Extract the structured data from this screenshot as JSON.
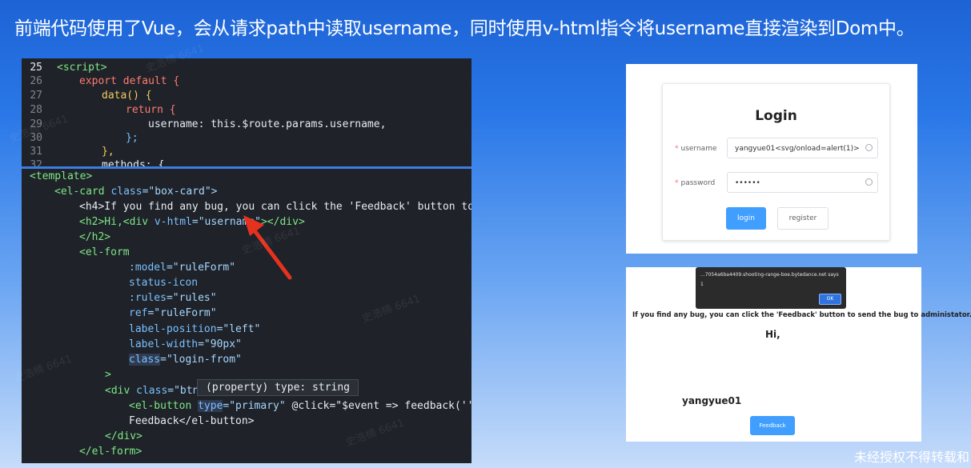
{
  "title": "前端代码使用了Vue，会从请求path中读取username，同时使用v-html指令将username直接渲染到Dom中。",
  "code_top": {
    "lines": [
      {
        "num": "25",
        "text": "<script>"
      },
      {
        "num": "26",
        "text": "export default {"
      },
      {
        "num": "27",
        "text": "data() {"
      },
      {
        "num": "28",
        "text": "return {"
      },
      {
        "num": "29",
        "text": "username: this.$route.params.username,"
      },
      {
        "num": "30",
        "text": "};"
      },
      {
        "num": "31",
        "text": "},"
      },
      {
        "num": "32",
        "text": "methods: {"
      }
    ]
  },
  "code_bottom": {
    "l1": "<template>",
    "l2a": "<el-card ",
    "l2b": "class",
    "l2c": "=\"box-card\">",
    "l3": "<h4>If you find any bug, you can click the 'Feedback' button to",
    "l4a": "<h2>Hi,<div ",
    "l4b": "v-html",
    "l4c": "=\"username\"",
    "l4d": "></div>",
    "l5": "</h2>",
    "l6": "<el-form",
    "l7a": ":model",
    "l7b": "=\"ruleForm\"",
    "l8": "status-icon",
    "l9a": ":rules",
    "l9b": "=\"rules\"",
    "l10a": "ref",
    "l10b": "=\"ruleForm\"",
    "l11a": "label-position",
    "l11b": "=\"left\"",
    "l12a": "label-width",
    "l12b": "=\"90px\"",
    "l13a": "class",
    "l13b": "=\"login-from\"",
    "l14": ">",
    "l15a": "<div ",
    "l15b": "class",
    "l15c": "=\"btn",
    "l16a": "<el-button ",
    "l16b": "type",
    "l16c": "=\"primary\"",
    "l16d": " @click=\"$event => feedback(''",
    "l17": "Feedback</el-button>",
    "l18": "</div>",
    "l19": "</el-form>",
    "tooltip": "(property) type: string"
  },
  "login": {
    "title": "Login",
    "username_label": "username",
    "username_value": "yangyue01<svg/onload=alert(1)>",
    "password_label": "password",
    "password_value": "••••••",
    "login_button": "login",
    "register_button": "register"
  },
  "result": {
    "alert_host": "...7054a6ba4409.shooting-range-boe.bytedance.net says",
    "alert_msg": "1",
    "alert_ok": "OK",
    "bug_text": "If you find any bug, you can click the 'Feedback' button to send the bug to administator.",
    "hi": "Hi,",
    "username": "yangyue01",
    "feedback_button": "Feedback"
  },
  "watermark": "史浩楠 6641",
  "footer": "未经授权不得转载和"
}
